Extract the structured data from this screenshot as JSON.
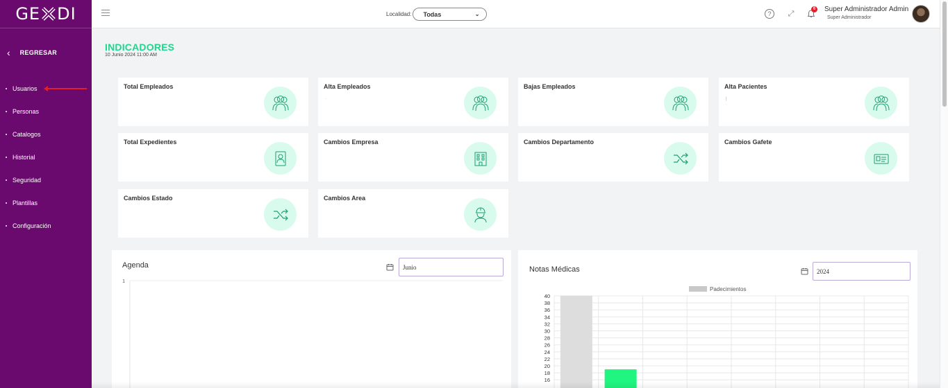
{
  "brand": {
    "logo_left": "GE",
    "logo_right": "DI"
  },
  "sidebar": {
    "back_label": "REGRESAR",
    "items": [
      {
        "label": "Usuarios"
      },
      {
        "label": "Personas"
      },
      {
        "label": "Catalogos"
      },
      {
        "label": "Historial"
      },
      {
        "label": "Seguridad"
      },
      {
        "label": "Plantillas"
      },
      {
        "label": "Configuración"
      }
    ]
  },
  "topbar": {
    "location_label": "Localidad:",
    "location_value": "Todas",
    "notification_count": "6",
    "user_name": "Super Administrador Admin",
    "user_role": "Super Administrador"
  },
  "page": {
    "title": "INDICADORES",
    "date": "10 Junio 2024 11:00 AM"
  },
  "indicators": [
    {
      "label": "Total Empleados",
      "value": "",
      "icon": "group-icon"
    },
    {
      "label": "Alta Empleados",
      "value": "·",
      "icon": "group-icon"
    },
    {
      "label": "Bajas Empleados",
      "value": "",
      "icon": "group-icon"
    },
    {
      "label": "Alta Pacientes",
      "value": "|",
      "icon": "group-icon"
    },
    {
      "label": "Total Expedientes",
      "value": "",
      "icon": "id-badge-icon"
    },
    {
      "label": "Cambios Empresa",
      "value": "",
      "icon": "building-icon"
    },
    {
      "label": "Cambios Departamento",
      "value": "",
      "icon": "shuffle-icon"
    },
    {
      "label": "Cambios Gafete",
      "value": "",
      "icon": "id-card-icon"
    },
    {
      "label": "Cambios Estado",
      "value": "",
      "icon": "shuffle-icon"
    },
    {
      "label": "Cambios Area",
      "value": "",
      "icon": "worker-icon"
    }
  ],
  "agenda": {
    "title": "Agenda",
    "month": "Junio"
  },
  "notas": {
    "title": "Notas Médicas",
    "year": "2024"
  },
  "chart_data": [
    {
      "type": "line",
      "title": "Agenda",
      "y_ticks": [
        "1"
      ],
      "ylim": [
        0,
        1
      ],
      "series": []
    },
    {
      "type": "bar",
      "title": "Notas Médicas",
      "legend": [
        "Padecimientos"
      ],
      "legend_position": "top",
      "grid": true,
      "y_ticks": [
        16,
        18,
        20,
        22,
        24,
        26,
        28,
        30,
        32,
        34,
        36,
        38,
        40
      ],
      "ylim": [
        15,
        40
      ],
      "series": [
        {
          "name": "Padecimientos",
          "values": [
            40,
            19
          ],
          "colors": [
            "#dddddd",
            "#1ff57f"
          ]
        }
      ],
      "legend_color": "#c8c8c8"
    }
  ],
  "colors": {
    "accent": "#1fd68e",
    "sidebar": "#6b0a6e",
    "icon_bg": "#d9fbee"
  }
}
